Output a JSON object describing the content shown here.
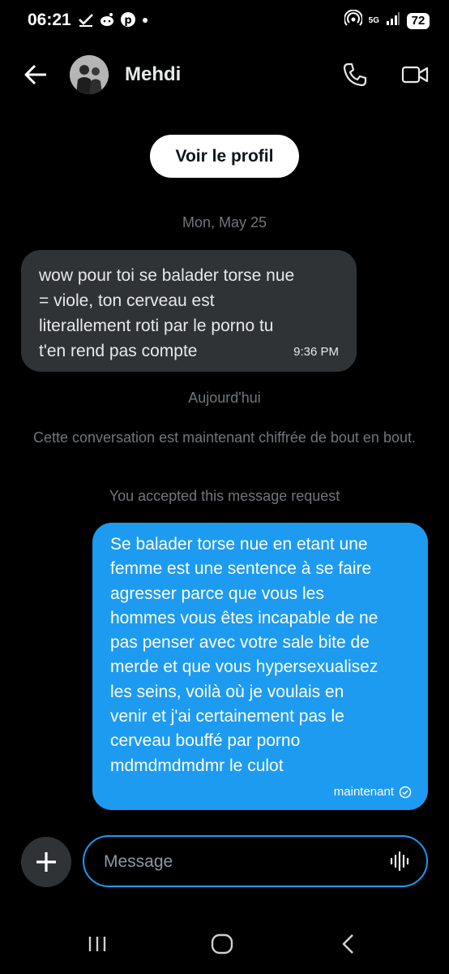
{
  "status_bar": {
    "time": "06:21",
    "network": "5G",
    "battery": "72"
  },
  "header": {
    "contact_name": "Mehdi"
  },
  "conversation": {
    "profile_button_label": "Voir le profil",
    "date_first": "Mon, May 25",
    "received_message": {
      "text": "wow pour toi se balader torse nue\n= viole, ton cerveau est\nliterallement roti par le porno tu\nt'en rend pas compte",
      "time": "9:36 PM"
    },
    "date_today": "Aujourd'hui",
    "encryption_notice": "Cette conversation est maintenant chiffrée de bout en bout.",
    "request_notice": "You accepted this message request",
    "sent_message": {
      "text": "Se balader torse nue en etant une\nfemme est une sentence à se faire\nagresser parce que vous les\nhommes vous êtes incapable de ne\npas penser avec votre sale bite de\nmerde et que vous hypersexualisez\nles seins, voilà où je voulais en\nvenir et j'ai certainement pas le\ncerveau bouffé par porno\nmdmdmdmdmr le culot",
      "status": "maintenant"
    }
  },
  "composer": {
    "placeholder": "Message"
  },
  "colors": {
    "background": "#000000",
    "accent": "#1d9bf0",
    "received_bubble": "#2f3336",
    "muted_text": "#71767b"
  }
}
